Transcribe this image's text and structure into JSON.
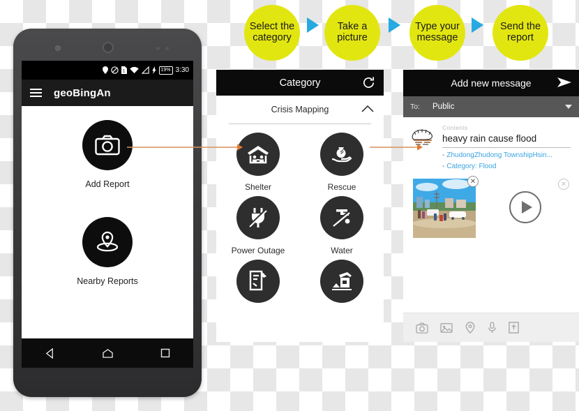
{
  "steps": [
    {
      "line1": "Select the",
      "line2": "category"
    },
    {
      "line1": "Take a",
      "line2": "picture"
    },
    {
      "line1": "Type your",
      "line2": "message"
    },
    {
      "line1": "Send the",
      "line2": "report"
    }
  ],
  "colors": {
    "step_yellow": "#e2e610",
    "step_arrow_blue": "#27a9e1",
    "connector_orange": "#d98f5a",
    "dark_header": "#0b0b0b",
    "link_blue": "#3aa3e0"
  },
  "phone": {
    "statusbar": {
      "time": "3:30",
      "battery_percent": "19%",
      "icons": [
        "location-pin-icon",
        "do-not-disturb-icon",
        "sim-card-icon",
        "wifi-icon",
        "signal-icon",
        "charging-bolt-icon",
        "battery-icon"
      ]
    },
    "appbar": {
      "menu_icon": "hamburger-menu-icon",
      "title": "geoBingAn"
    },
    "actions": [
      {
        "icon": "camera-icon",
        "label": "Add Report"
      },
      {
        "icon": "location-pin-map-icon",
        "label": "Nearby Reports"
      }
    ],
    "navbar": [
      "back-triangle-icon",
      "home-icon",
      "recents-square-icon"
    ]
  },
  "category_panel": {
    "header": {
      "title": "Category",
      "refresh_icon": "refresh-icon"
    },
    "group": {
      "label": "Crisis Mapping",
      "chevron": "chevron-up-icon"
    },
    "items": [
      {
        "icon": "shelter-icon",
        "label": "Shelter"
      },
      {
        "icon": "rescue-hand-icon",
        "label": "Rescue"
      },
      {
        "icon": "power-plug-icon",
        "label": "Power Outage"
      },
      {
        "icon": "water-faucet-icon",
        "label": "Water"
      },
      {
        "icon": "damage-report-icon",
        "label": ""
      },
      {
        "icon": "collapsed-house-icon",
        "label": ""
      }
    ]
  },
  "message_panel": {
    "header": {
      "title": "Add new message",
      "send_icon": "send-arrow-icon"
    },
    "recipient": {
      "label": "To:",
      "value": "Public",
      "dropdown_icon": "chevron-down-icon"
    },
    "contents": {
      "label": "Contents",
      "value": "heavy rain cause flood",
      "thumbnail_icon": "sketch-doodle-icon"
    },
    "meta": [
      {
        "dash": "-",
        "text": "ZhudongZhudong TownshipHsin..."
      },
      {
        "dash": "-",
        "text": "Category:  Flood"
      }
    ],
    "media": {
      "photo_alt": "flood-photo",
      "photo_remove_icon": "close-circle-icon",
      "audio_remove_icon": "close-circle-icon",
      "play_icon": "play-circle-icon"
    },
    "toolbar": [
      {
        "icon": "camera-icon"
      },
      {
        "icon": "gallery-image-icon"
      },
      {
        "icon": "location-pin-icon"
      },
      {
        "icon": "microphone-icon"
      },
      {
        "icon": "attach-file-icon"
      }
    ]
  }
}
